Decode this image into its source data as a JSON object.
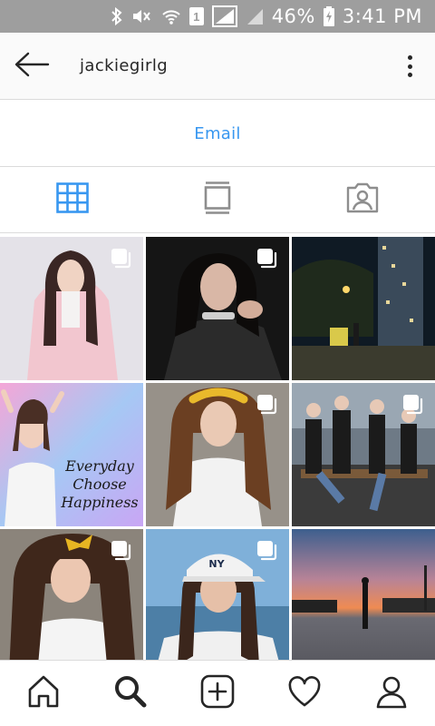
{
  "status_bar": {
    "sim_slot": "1",
    "battery": "46%",
    "time": "3:41 PM"
  },
  "header": {
    "username": "jackiegirlg",
    "back_icon": "arrow-left-icon",
    "more_icon": "more-vertical-icon"
  },
  "actions": {
    "email_label": "Email"
  },
  "tabs": [
    {
      "icon": "grid-icon",
      "active": true
    },
    {
      "icon": "feed-list-icon",
      "active": false
    },
    {
      "icon": "tagged-person-icon",
      "active": false
    }
  ],
  "posts": [
    {
      "description": "girl in pink blazer",
      "multi": true
    },
    {
      "description": "girl in black mesh top",
      "multi": true
    },
    {
      "description": "night street with city lights",
      "multi": false
    },
    {
      "description": "Everyday Choose Happiness",
      "multi": false
    },
    {
      "description": "girl with yellow headband",
      "multi": true
    },
    {
      "description": "group of friends on bench",
      "multi": true
    },
    {
      "description": "girl with yellow bow",
      "multi": true
    },
    {
      "description": "girl in NY cap at beach",
      "multi": true
    },
    {
      "description": "sunset parking lot",
      "multi": false
    }
  ],
  "post_overlay": {
    "text": [
      "Everyday",
      "Choose",
      "Happiness"
    ]
  },
  "colors": {
    "accent": "#3897f0",
    "status_bar": "#9e9e9e",
    "divider": "#dbdbdb"
  },
  "bottom_nav": [
    {
      "icon": "home-icon"
    },
    {
      "icon": "search-icon"
    },
    {
      "icon": "add-post-icon"
    },
    {
      "icon": "heart-icon"
    },
    {
      "icon": "profile-icon"
    }
  ]
}
